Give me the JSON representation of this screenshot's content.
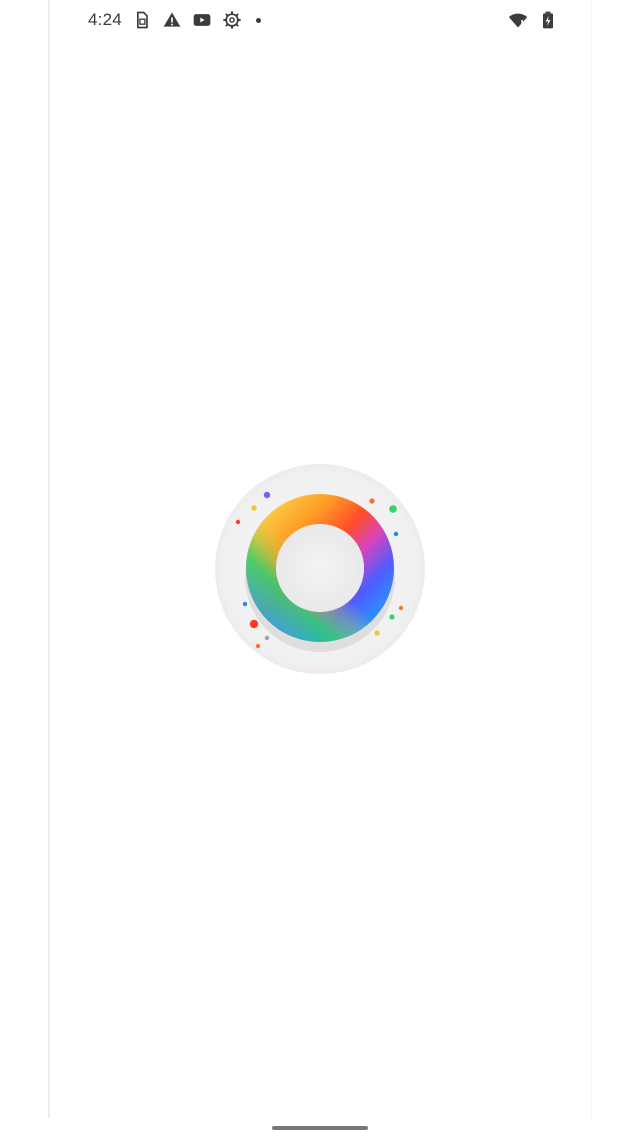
{
  "status_bar": {
    "time": "4:24",
    "icons_left": [
      "sim-card-icon",
      "warning-icon",
      "youtube-icon",
      "settings-icon",
      "notification-dot-icon"
    ],
    "icons_right": [
      "wifi-icon",
      "battery-icon"
    ]
  },
  "splash": {
    "logo": "rainbow-ring-logo",
    "ring_colors": [
      "#f5c52e",
      "#ff8a1f",
      "#ff3d1f",
      "#d63fb2",
      "#4b59ff",
      "#1fa0ff",
      "#33c96a"
    ]
  },
  "nav": {
    "gesture_bar": "gesture-handle"
  }
}
